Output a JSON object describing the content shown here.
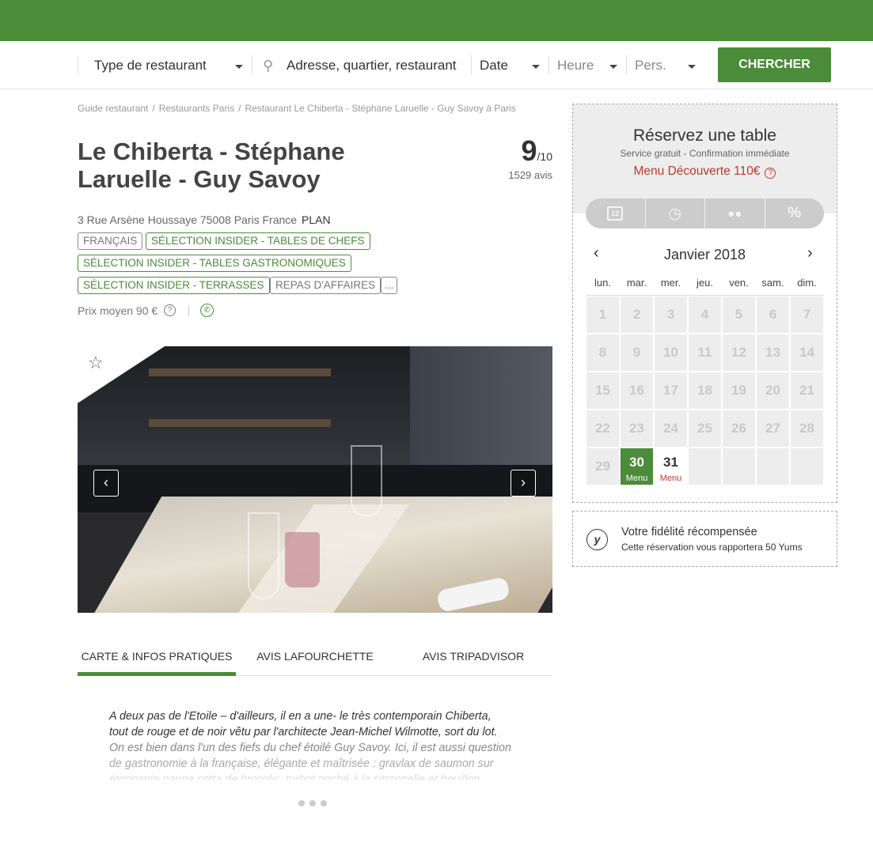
{
  "search": {
    "type_label": "Type de restaurant",
    "address_placeholder": "Adresse, quartier, restaurant",
    "date_label": "Date",
    "hour_label": "Heure",
    "pers_label": "Pers.",
    "button_label": "CHERCHER"
  },
  "breadcrumb": [
    "Guide restaurant",
    "Restaurants Paris",
    "Restaurant Le Chiberta - Stéphane Laruelle - Guy Savoy à Paris"
  ],
  "restaurant": {
    "name": "Le Chiberta - Stéphane Laruelle - Guy Savoy",
    "rating": "9",
    "rating_scale": "/10",
    "reviews": "1529 avis",
    "address": "3 Rue Arsène Houssaye 75008 Paris France",
    "plan_label": "PLAN",
    "tags": [
      "FRANÇAIS",
      "SÉLECTION INSIDER - TABLES DE CHEFS",
      "SÉLECTION INSIDER - TABLES GASTRONOMIQUES",
      "SÉLECTION INSIDER - TERRASSES",
      "REPAS D'AFFAIRES",
      "..."
    ],
    "price": "Prix moyen 90 €"
  },
  "tabs": [
    "CARTE & INFOS PRATIQUES",
    "AVIS LAFOURCHETTE",
    "AVIS TRIPADVISOR"
  ],
  "description": {
    "line1": "A deux pas de l'Etoile – d'ailleurs, il en a une- le très contemporain Chiberta,",
    "line2": "tout de rouge et de noir vêtu par l'architecte Jean-Michel Wilmotte, sort du lot.",
    "line3": "On est bien dans l'un des fiefs du chef étoilé Guy Savoy. Ici, il est aussi question",
    "line4": "de gastronomie à la française, élégante et maîtrisée : gravlax de saumon sur",
    "line5": "étonnante panna cotta de brocolis, turbot poché à la citronnelle et bouillon"
  },
  "reservation": {
    "title": "Réservez une table",
    "subtitle": "Service gratuit - Confirmation immédiate",
    "menu": "Menu Découverte 110€",
    "steps": [
      "12",
      "◷",
      "👥",
      "%"
    ],
    "month": "Janvier 2018",
    "weekdays": [
      "lun.",
      "mar.",
      "mer.",
      "jeu.",
      "ven.",
      "sam.",
      "dim."
    ],
    "days": [
      {
        "n": "1"
      },
      {
        "n": "2"
      },
      {
        "n": "3"
      },
      {
        "n": "4"
      },
      {
        "n": "5"
      },
      {
        "n": "6"
      },
      {
        "n": "7"
      },
      {
        "n": "8"
      },
      {
        "n": "9"
      },
      {
        "n": "10"
      },
      {
        "n": "11"
      },
      {
        "n": "12"
      },
      {
        "n": "13"
      },
      {
        "n": "14"
      },
      {
        "n": "15"
      },
      {
        "n": "16"
      },
      {
        "n": "17"
      },
      {
        "n": "18"
      },
      {
        "n": "19"
      },
      {
        "n": "20"
      },
      {
        "n": "21"
      },
      {
        "n": "22"
      },
      {
        "n": "23"
      },
      {
        "n": "24"
      },
      {
        "n": "25"
      },
      {
        "n": "26"
      },
      {
        "n": "27"
      },
      {
        "n": "28"
      },
      {
        "n": "29"
      },
      {
        "n": "30",
        "state": "sel",
        "label": "Menu"
      },
      {
        "n": "31",
        "state": "avail",
        "label": "Menu"
      },
      {
        "n": ""
      },
      {
        "n": ""
      },
      {
        "n": ""
      },
      {
        "n": ""
      }
    ]
  },
  "loyalty": {
    "icon": "y",
    "title": "Votre fidélité récompensée",
    "subtitle": "Cette réservation vous rapportera 50 Yums"
  }
}
